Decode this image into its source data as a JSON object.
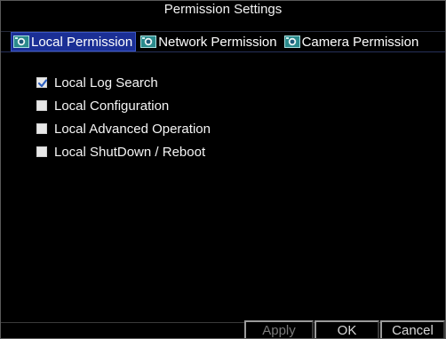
{
  "window": {
    "title": "Permission Settings"
  },
  "tabs": [
    {
      "label": "Local Permission",
      "icon": "camera-icon",
      "active": true
    },
    {
      "label": "Network Permission",
      "icon": "camera-icon",
      "active": false
    },
    {
      "label": "Camera Permission",
      "icon": "camera-icon",
      "active": false
    }
  ],
  "permissions": [
    {
      "label": "Local Log Search",
      "checked": true
    },
    {
      "label": "Local Configuration",
      "checked": false
    },
    {
      "label": "Local Advanced Operation",
      "checked": false
    },
    {
      "label": "Local ShutDown / Reboot",
      "checked": false
    }
  ],
  "buttons": {
    "apply_label": "Apply",
    "ok_label": "OK",
    "cancel_label": "Cancel"
  },
  "colors": {
    "background": "#000000",
    "tab_active_bg": "#1b2f95",
    "text": "#f5f5f5",
    "check_mark": "#2d5fbf"
  }
}
